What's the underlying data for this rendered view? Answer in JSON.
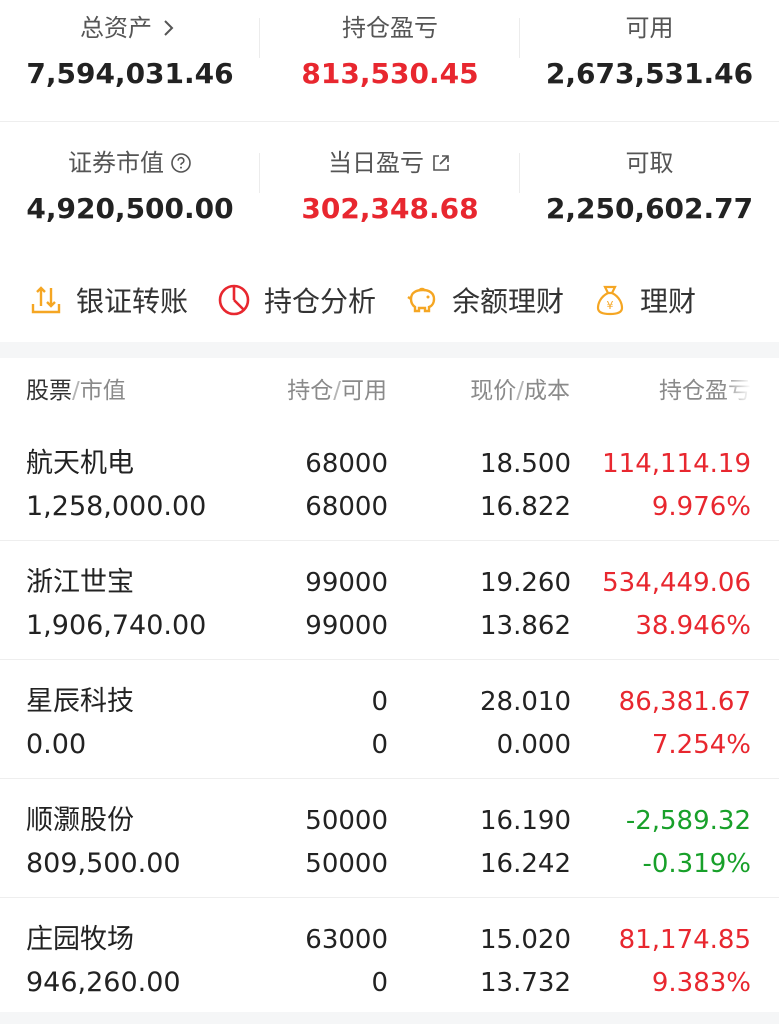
{
  "summary": {
    "total_assets_label": "总资产",
    "total_assets_value": "7,594,031.46",
    "position_pl_label": "持仓盈亏",
    "position_pl_value": "813,530.45",
    "available_label": "可用",
    "available_value": "2,673,531.46",
    "market_value_label": "证券市值",
    "market_value_value": "4,920,500.00",
    "daily_pl_label": "当日盈亏",
    "daily_pl_value": "302,348.68",
    "withdrawable_label": "可取",
    "withdrawable_value": "2,250,602.77"
  },
  "actions": [
    {
      "label": "银证转账",
      "icon": "transfer-icon"
    },
    {
      "label": "持仓分析",
      "icon": "pie-chart-icon"
    },
    {
      "label": "余额理财",
      "icon": "piggy-bank-icon"
    },
    {
      "label": "理财",
      "icon": "money-bag-icon"
    }
  ],
  "table": {
    "headers": {
      "col1_a": "股票",
      "col1_b": "市值",
      "col2_a": "持仓",
      "col2_b": "可用",
      "col3_a": "现价",
      "col3_b": "成本",
      "col4": "持仓盈亏",
      "sep": "/"
    },
    "rows": [
      {
        "name": "航天机电",
        "market_value": "1,258,000.00",
        "holding": "68000",
        "available": "68000",
        "price": "18.500",
        "cost": "16.822",
        "pl": "114,114.19",
        "pl_pct": "9.976%",
        "trend": "up"
      },
      {
        "name": "浙江世宝",
        "market_value": "1,906,740.00",
        "holding": "99000",
        "available": "99000",
        "price": "19.260",
        "cost": "13.862",
        "pl": "534,449.06",
        "pl_pct": "38.946%",
        "trend": "up"
      },
      {
        "name": "星辰科技",
        "market_value": "0.00",
        "holding": "0",
        "available": "0",
        "price": "28.010",
        "cost": "0.000",
        "pl": "86,381.67",
        "pl_pct": "7.254%",
        "trend": "up"
      },
      {
        "name": "顺灏股份",
        "market_value": "809,500.00",
        "holding": "50000",
        "available": "50000",
        "price": "16.190",
        "cost": "16.242",
        "pl": "-2,589.32",
        "pl_pct": "-0.319%",
        "trend": "down"
      },
      {
        "name": "庄园牧场",
        "market_value": "946,260.00",
        "holding": "63000",
        "available": "0",
        "price": "15.020",
        "cost": "13.732",
        "pl": "81,174.85",
        "pl_pct": "9.383%",
        "trend": "up"
      }
    ]
  },
  "colors": {
    "up": "#e8272f",
    "down": "#18a02a",
    "accent_orange": "#f5a623",
    "accent_red": "#e8272f"
  }
}
